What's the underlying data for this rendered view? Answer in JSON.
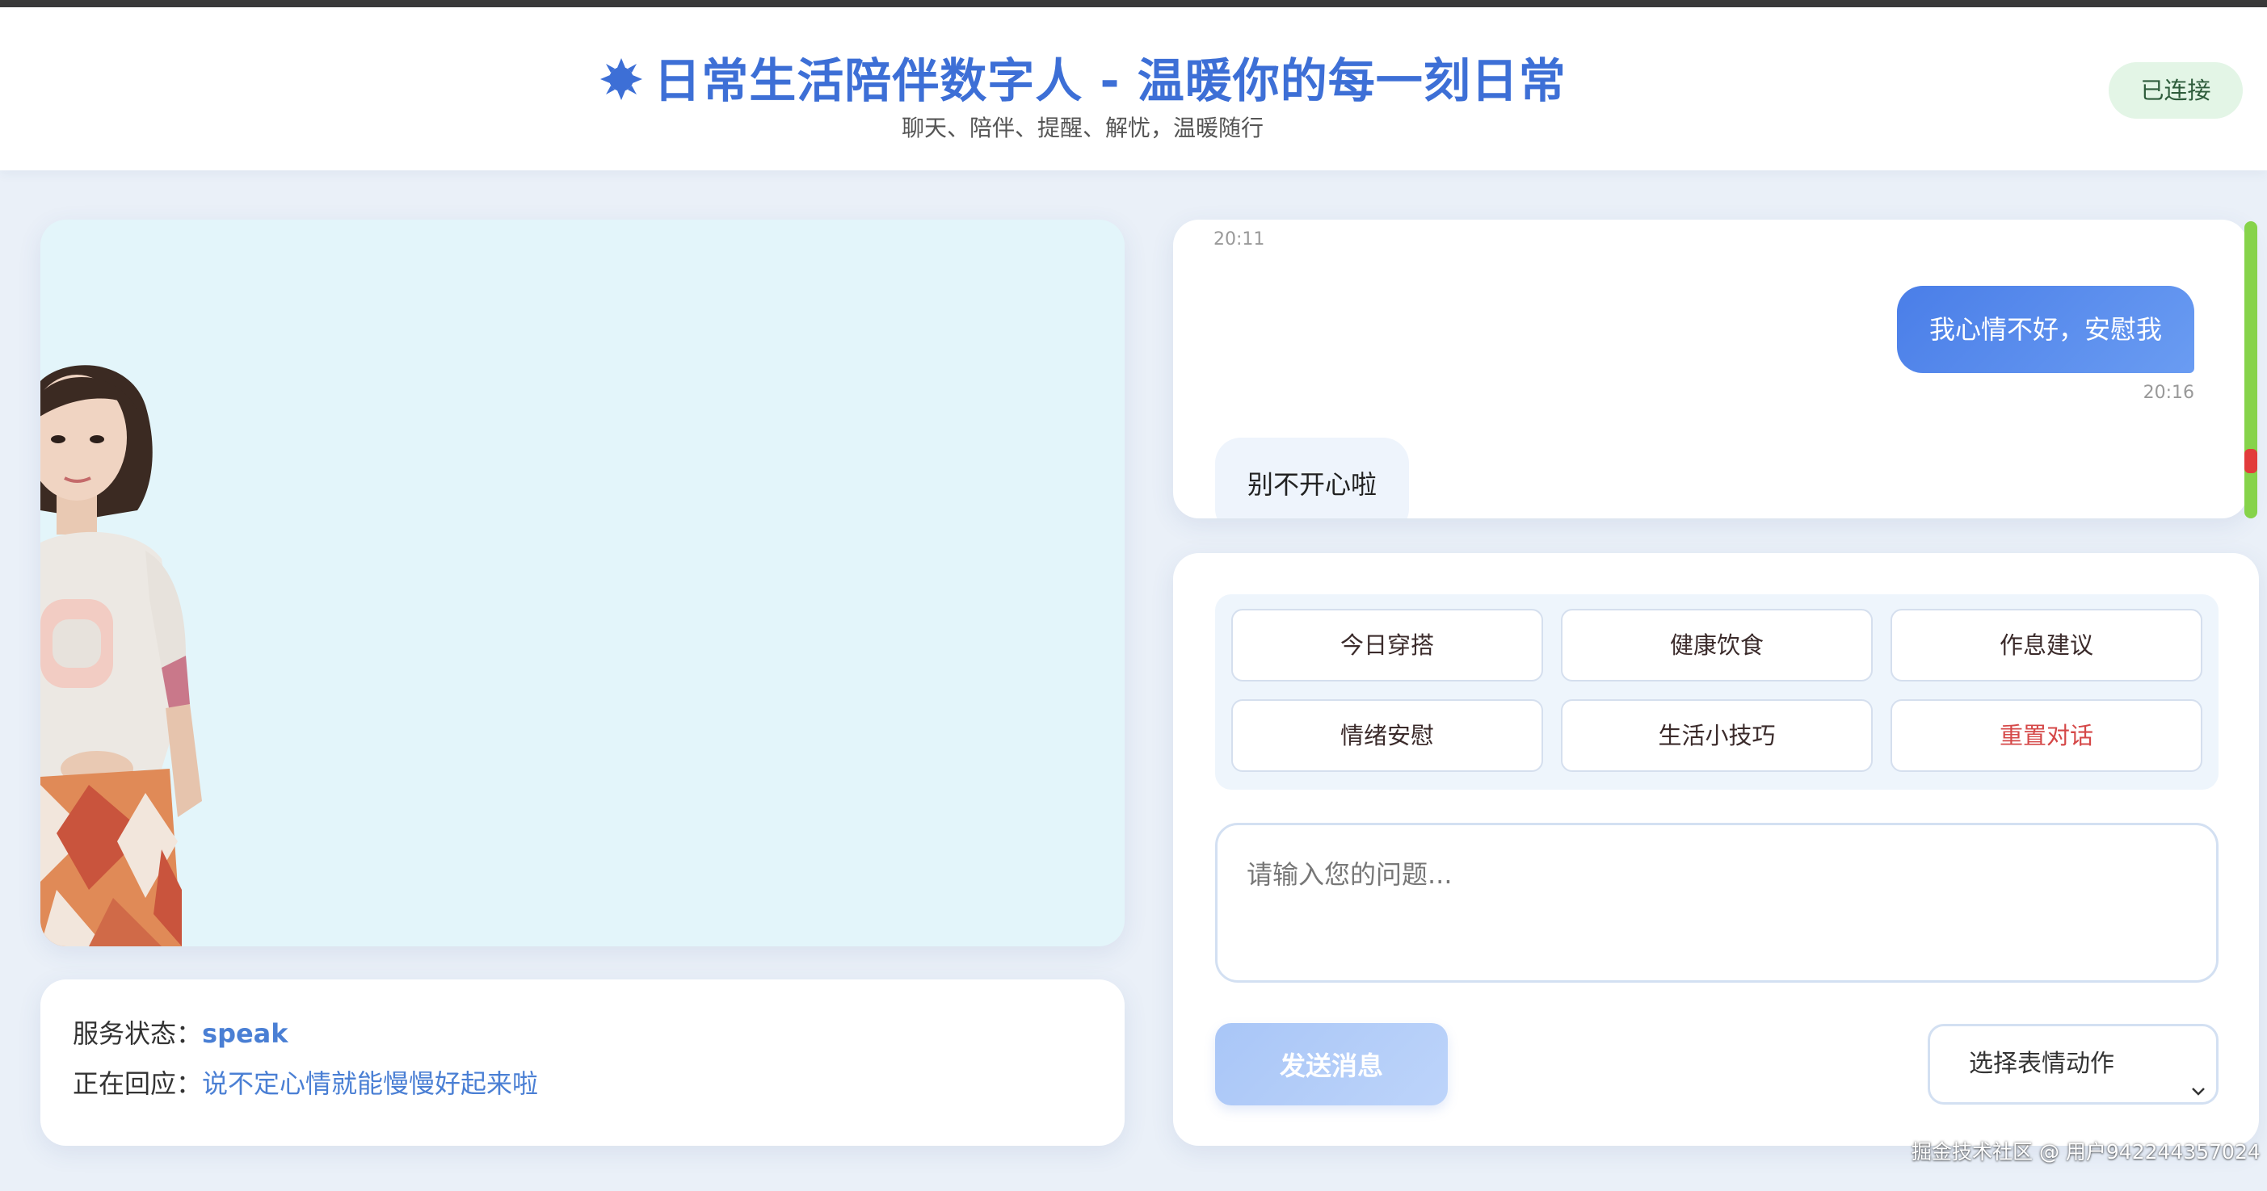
{
  "header": {
    "title": "日常生活陪伴数字人 - 温暖你的每一刻日常",
    "subtitle": "聊天、陪伴、提醒、解忧，温暖随行",
    "connection_status": "已连接"
  },
  "status": {
    "service_label": "服务状态：",
    "service_value": "speak",
    "reply_label": "正在回应：",
    "reply_value": "说不定心情就能慢慢好起来啦"
  },
  "chat": {
    "messages": [
      {
        "role": "assistant",
        "time": "20:11"
      },
      {
        "role": "user",
        "text": "我心情不好，安慰我",
        "time": "20:16"
      },
      {
        "role": "assistant",
        "text": "别不开心啦"
      }
    ]
  },
  "quick_actions": [
    "今日穿搭",
    "健康饮食",
    "作息建议",
    "情绪安慰",
    "生活小技巧",
    "重置对话"
  ],
  "input": {
    "placeholder": "请输入您的问题..."
  },
  "send_label": "发送消息",
  "expression_select": {
    "selected": "选择表情动作"
  },
  "watermark": "掘金技术社区 @ 用户942244357024",
  "colors": {
    "accent": "#3d6fd6",
    "user_bubble": "#4a7ee8",
    "reset_text": "#d54848",
    "connected_bg": "#e3f5e6",
    "avatar_bg": "#e3f5fa"
  },
  "icons": {
    "title_icon": "sun-badge-icon",
    "select_chevron": "chevron-down-icon"
  }
}
